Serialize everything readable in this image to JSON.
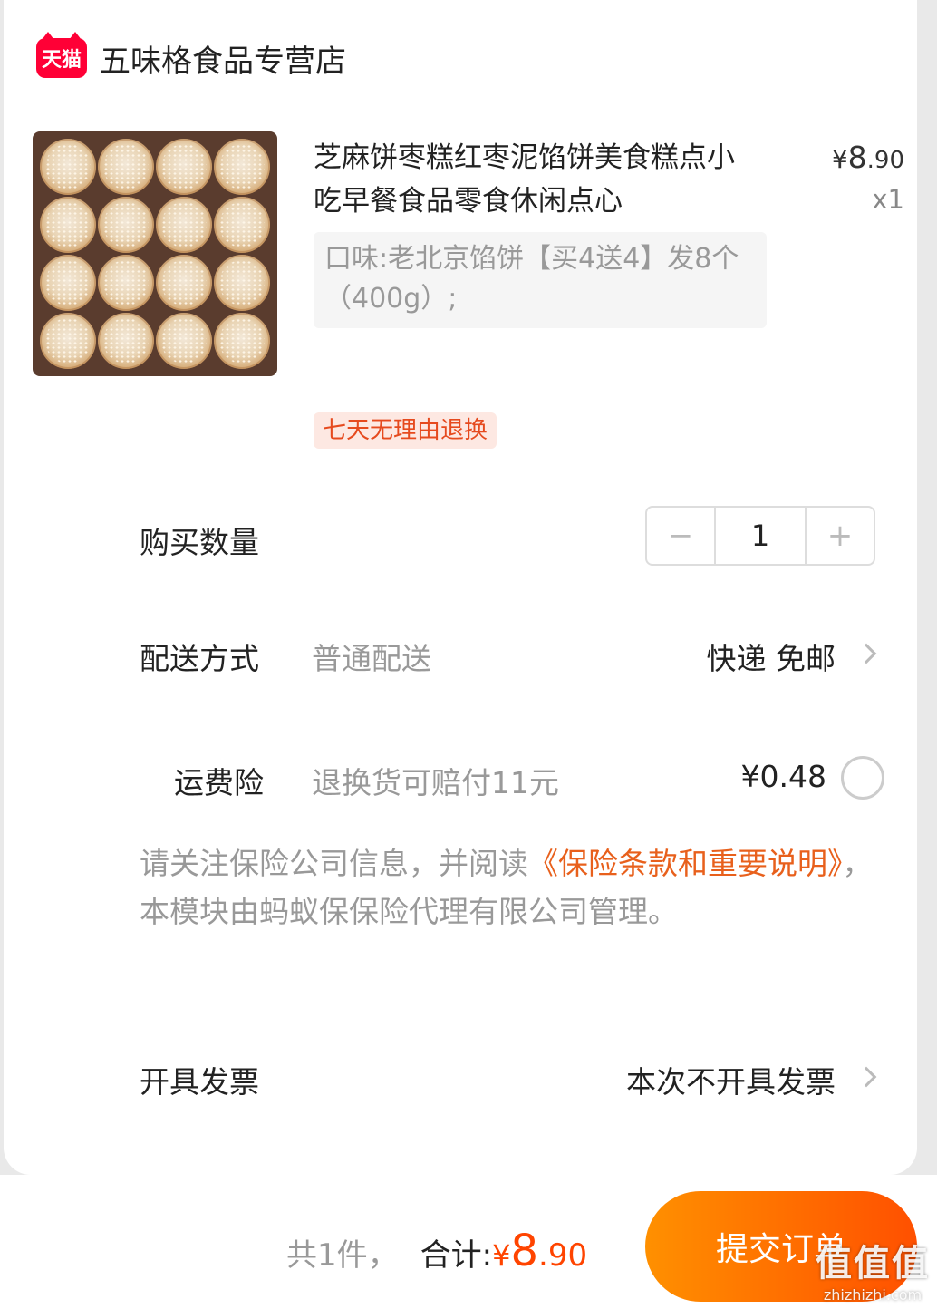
{
  "shop": {
    "badge": "天猫",
    "name": "五味格食品专营店"
  },
  "item": {
    "title": "芝麻饼枣糕红枣泥馅饼美食糕点小吃早餐食品零食休闲点心",
    "price_yen": "¥",
    "price_int": "8",
    "price_cents": ".90",
    "quantity_text": "x1",
    "sku": "口味:老北京馅饼【买4送4】发8个（400g）;",
    "tag": "七天无理由退换",
    "image": "sesame-pastry-tray"
  },
  "quantity": {
    "label": "购买数量",
    "minus": "−",
    "value": "1",
    "plus": "+"
  },
  "delivery": {
    "label": "配送方式",
    "method": "普通配送",
    "value": "快递 免邮"
  },
  "insurance": {
    "label": "运费险",
    "desc": "退换货可赔付11元",
    "price": "¥0.48",
    "notice_pre": "请关注保险公司信息，并阅读",
    "notice_link": "《保险条款和重要说明》",
    "notice_post": "，本模块由蚂蚁保保险代理有限公司管理。"
  },
  "invoice": {
    "label": "开具发票",
    "value": "本次不开具发票"
  },
  "footer": {
    "count": "共1件，",
    "total_label": "合计:",
    "total_yen": "¥",
    "total_int": "8",
    "total_cents": ".90",
    "submit": "提交订单"
  },
  "watermark": {
    "logo": "值值值",
    "url": "zhizhizhi.com"
  },
  "colors": {
    "tmall": "#ff0036",
    "accent": "#ff5000",
    "link": "#e8601c"
  }
}
